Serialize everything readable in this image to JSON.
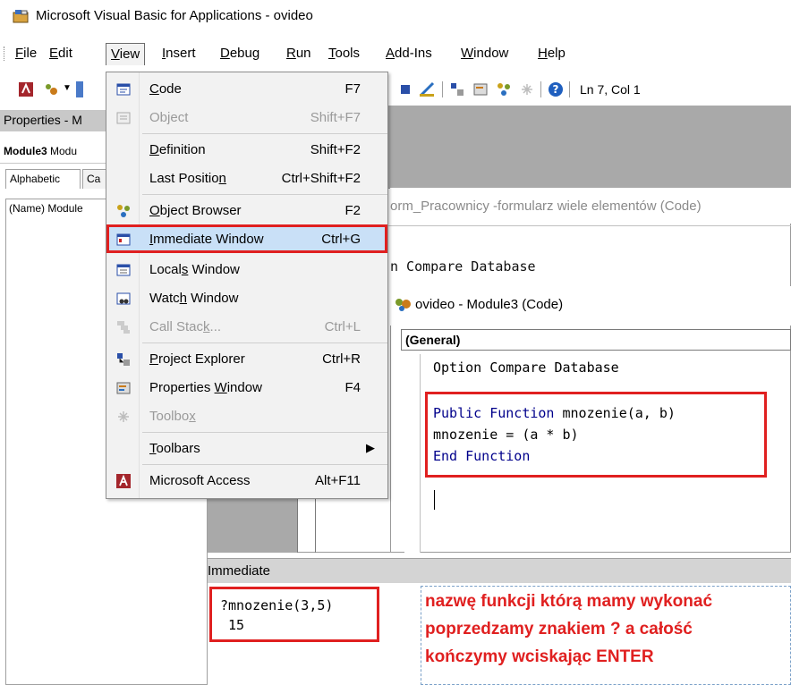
{
  "window": {
    "title": "Microsoft Visual Basic for Applications - ovideo"
  },
  "menubar": {
    "items": [
      {
        "id": "file",
        "label": "File",
        "hot": "F",
        "rest": "ile"
      },
      {
        "id": "edit",
        "label": "Edit",
        "hot": "E",
        "rest": "dit"
      },
      {
        "id": "view",
        "label": "View",
        "hot": "V",
        "rest": "iew"
      },
      {
        "id": "insert",
        "label": "Insert",
        "hot": "I",
        "rest": "nsert"
      },
      {
        "id": "debug",
        "label": "Debug",
        "hot": "D",
        "rest": "ebug"
      },
      {
        "id": "run",
        "label": "Run",
        "hot": "R",
        "rest": "un"
      },
      {
        "id": "tools",
        "label": "Tools",
        "hot": "T",
        "rest": "ools"
      },
      {
        "id": "addins",
        "label": "Add-Ins",
        "hot": "A",
        "rest": "dd-Ins"
      },
      {
        "id": "window",
        "label": "Window",
        "hot": "W",
        "rest": "indow"
      },
      {
        "id": "help",
        "label": "Help",
        "hot": "H",
        "rest": "elp"
      }
    ]
  },
  "toolbar": {
    "status": "Ln 7, Col 1"
  },
  "properties": {
    "title": "Properties - M",
    "combo_bold": "Module3",
    "combo_rest": " Modu",
    "tab_alphabetic": "Alphabetic",
    "tab_categorized": "Ca",
    "row_name": "(Name)",
    "row_value": "Module"
  },
  "form_window": {
    "title": "orm_Pracownicy -formularz wiele elementów (Code)",
    "code_line": "n Compare Database"
  },
  "module_window": {
    "title": "ovideo - Module3 (Code)",
    "combo": "(General)",
    "option_line": "Option Compare Database",
    "code": {
      "line1_kw1": "Public",
      "line1_kw2": "Function",
      "line1_rest": " mnozenie(a, b)",
      "line2": "mnozenie = (a * b)",
      "line3": "End Function"
    }
  },
  "immediate": {
    "title": "Immediate",
    "command": "?mnozenie(3,5)",
    "result": " 15"
  },
  "annotation": {
    "line1": "nazwę funkcji którą mamy wykonać",
    "line2": "poprzedzamy znakiem ? a całość",
    "line3": "kończymy wciskając ENTER"
  },
  "view_menu": {
    "items": [
      {
        "label": "Code",
        "pre": "",
        "hot": "C",
        "post": "ode",
        "shortcut": "F7",
        "icon": "code-window-icon",
        "disabled": false
      },
      {
        "label": "Object",
        "pre": "Ob",
        "hot": "j",
        "post": "ect",
        "shortcut": "Shift+F7",
        "icon": "object-icon",
        "disabled": true
      },
      {
        "label": "Definition",
        "pre": "",
        "hot": "D",
        "post": "efinition",
        "shortcut": "Shift+F2",
        "icon": "",
        "disabled": false
      },
      {
        "label": "Last Position",
        "pre": "Last Positio",
        "hot": "n",
        "post": "",
        "shortcut": "Ctrl+Shift+F2",
        "icon": "",
        "disabled": false
      },
      {
        "label": "Object Browser",
        "pre": "",
        "hot": "O",
        "post": "bject Browser",
        "shortcut": "F2",
        "icon": "object-browser-icon",
        "disabled": false
      },
      {
        "label": "Immediate Window",
        "pre": "",
        "hot": "I",
        "post": "mmediate Window",
        "shortcut": "Ctrl+G",
        "icon": "immediate-window-icon",
        "disabled": false
      },
      {
        "label": "Locals Window",
        "pre": "Local",
        "hot": "s",
        "post": " Window",
        "shortcut": "",
        "icon": "locals-window-icon",
        "disabled": false
      },
      {
        "label": "Watch Window",
        "pre": "Watc",
        "hot": "h",
        "post": " Window",
        "shortcut": "",
        "icon": "watch-window-icon",
        "disabled": false
      },
      {
        "label": "Call Stack...",
        "pre": "Call Stac",
        "hot": "k",
        "post": "...",
        "shortcut": "Ctrl+L",
        "icon": "call-stack-icon",
        "disabled": true
      },
      {
        "label": "Project Explorer",
        "pre": "",
        "hot": "P",
        "post": "roject Explorer",
        "shortcut": "Ctrl+R",
        "icon": "project-explorer-icon",
        "disabled": false
      },
      {
        "label": "Properties Window",
        "pre": "Properties ",
        "hot": "W",
        "post": "indow",
        "shortcut": "F4",
        "icon": "properties-window-icon",
        "disabled": false
      },
      {
        "label": "Toolbox",
        "pre": "Toolbo",
        "hot": "x",
        "post": "",
        "shortcut": "",
        "icon": "toolbox-icon",
        "disabled": true
      },
      {
        "label": "Toolbars",
        "pre": "",
        "hot": "T",
        "post": "oolbars",
        "shortcut": "",
        "icon": "",
        "disabled": false
      },
      {
        "label": "Microsoft Access",
        "pre": "Microsoft Access",
        "hot": "",
        "post": "",
        "shortcut": "Alt+F11",
        "icon": "microsoft-access-icon",
        "disabled": false
      }
    ]
  },
  "colors": {
    "accent_red": "#e02020",
    "keyword_blue": "#00008b",
    "menu_highlight": "#c9e0f7"
  }
}
